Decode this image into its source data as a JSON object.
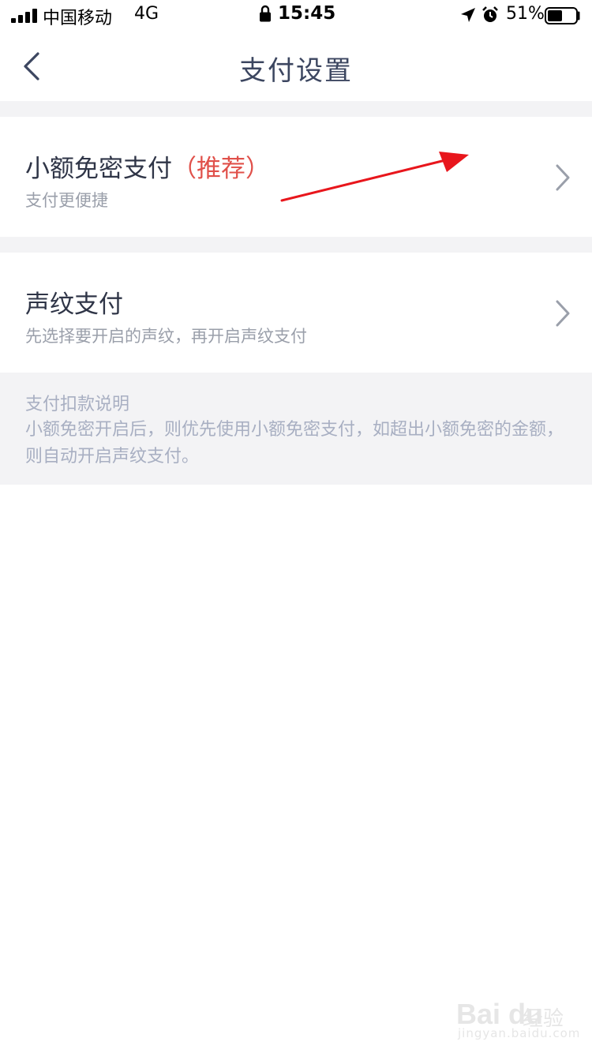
{
  "status_bar": {
    "carrier": "中国移动",
    "network": "4G",
    "time": "15:45",
    "battery": "51%",
    "icons": [
      "signal-icon",
      "lock-icon",
      "location-icon",
      "alarm-icon",
      "battery-icon"
    ]
  },
  "nav": {
    "title": "支付设置",
    "back_icon": "chevron-left-icon"
  },
  "settings": [
    {
      "title": "小额免密支付",
      "tag": "（推荐）",
      "subtitle": "支付更便捷"
    },
    {
      "title": "声纹支付",
      "subtitle": "先选择要开启的声纹，再开启声纹支付"
    }
  ],
  "info": {
    "title": "支付扣款说明",
    "text": "小额免密开启后，则优先使用小额免密支付，如超出小额免密的金额，则自动开启声纹支付。"
  },
  "watermark": {
    "logo": "Bai du",
    "text": "经验",
    "url": "jingyan.baidu.com"
  },
  "colors": {
    "accent_red": "#e0504a",
    "section_bg": "#f3f3f5",
    "annotation_arrow": "#e8161c"
  }
}
